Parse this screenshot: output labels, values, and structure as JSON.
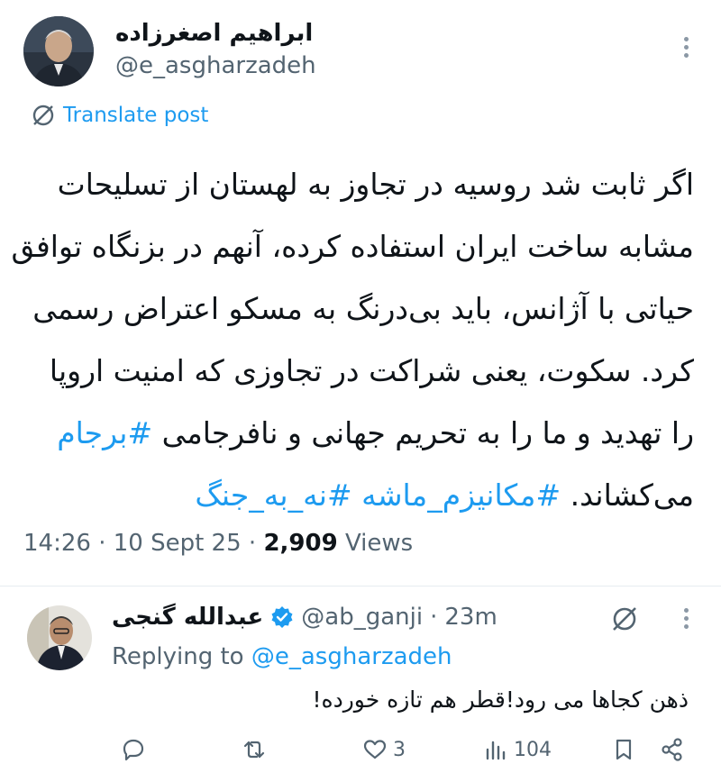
{
  "post": {
    "author_name": "ابراهیم اصغرزاده",
    "author_handle": "@e_asgharzadeh",
    "translate_label": "Translate post",
    "body_lines": [
      "اگر ثابت شد روسیه در تجاوز به لهستان از تسلیحات",
      "مشابه ساخت ایران استفاده کرده، آنهم در بزنگاه توافق",
      "حیاتی با آژانس، باید بی‌درنگ به مسکو اعتراض رسمی",
      "کرد. سکوت، یعنی شراکت در تجاوزی که امنیت اروپا"
    ],
    "line5_text": "را تهدید و ما را به تحریم جهانی و نافرجامی",
    "hashtag1": "#برجام",
    "line6_text": "می‌کشاند.",
    "hashtag2": "#مکانیزم_ماشه",
    "hashtag3": "#نه_به_جنگ",
    "time": "14:26",
    "sep1": "·",
    "date": "10 Sept 25",
    "sep2": "·",
    "views_count": "2,909",
    "views_label": "Views"
  },
  "reply": {
    "author_name": "عبدالله گنجی",
    "author_handle": "@ab_ganji",
    "sep": "·",
    "time": "23m",
    "replying_prefix": "Replying to",
    "replying_handle": "@e_asgharzadeh",
    "text": "ذهن کجاها می رود!قطر هم تازه خورده!",
    "likes": "3",
    "views": "104"
  },
  "colors": {
    "accent": "#1d9bf0",
    "secondary_text": "#536471",
    "verified": "#1d9bf0"
  },
  "icons": {
    "translate": "translate-icon",
    "more": "more-icon",
    "verified": "verified-badge-icon",
    "grok": "grok-icon",
    "reply": "reply-icon",
    "repost": "repost-icon",
    "like": "heart-icon",
    "views": "views-icon",
    "bookmark": "bookmark-icon",
    "share": "share-icon"
  }
}
